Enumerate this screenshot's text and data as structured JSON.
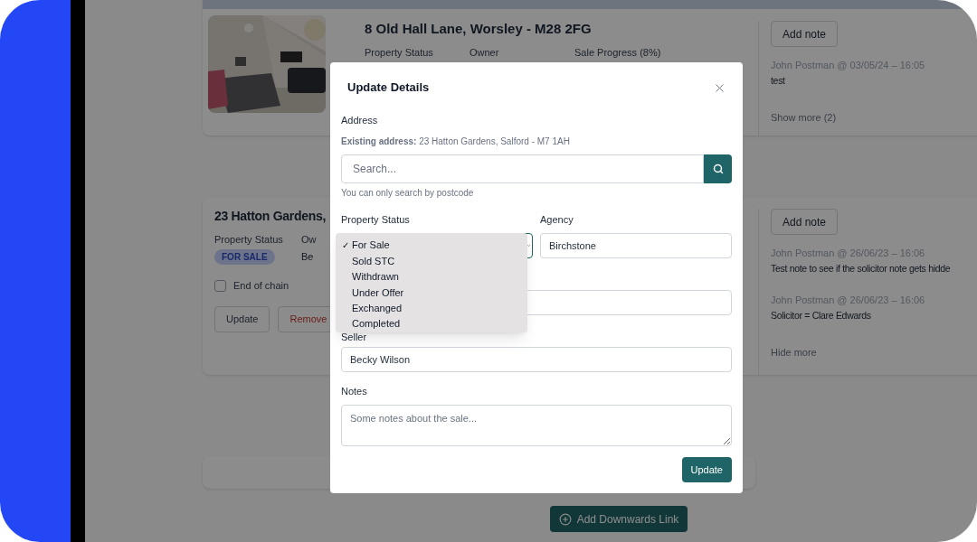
{
  "listing_cards": [
    {
      "title": "8 Old Hall Lane, Worsley - M28 2FG",
      "fields": [
        {
          "label": "Property Status"
        },
        {
          "label": "Owner"
        },
        {
          "label": "Sale Progress (8%)"
        }
      ],
      "notes_panel": {
        "button": "Add note",
        "notes": [
          {
            "meta": "John Postman @ 03/05/24 – 16:05",
            "text": "test"
          }
        ],
        "toggle": "Show more (2)"
      }
    },
    {
      "title": "23 Hatton Gardens,",
      "fields": [
        {
          "label": "Property Status",
          "badge": "FOR SALE"
        },
        {
          "label": "Ow",
          "value": "Be"
        }
      ],
      "checkbox": {
        "label": "End of chain",
        "checked": false
      },
      "buttons": [
        {
          "label": "Update",
          "kind": "default"
        },
        {
          "label": "Remove",
          "kind": "danger"
        }
      ],
      "notes_panel": {
        "button": "Add note",
        "notes": [
          {
            "meta": "John Postman @ 26/06/23 – 16:06",
            "text": "Test note to see if the solicitor note gets hidde"
          },
          {
            "meta": "John Postman @ 26/06/23 – 16:06",
            "text": "Solicitor = Clare Edwards"
          }
        ],
        "toggle": "Hide more"
      }
    }
  ],
  "footer_button": "Add Downwards Link",
  "modal": {
    "title": "Update Details",
    "address_label": "Address",
    "existing_address": "**Existing address:** 23 Hatton Gardens, Salford - M7 1AH",
    "search": {
      "placeholder": "Search..."
    },
    "search_hint": "You can only search by postcode",
    "property_status": {
      "label": "Property Status",
      "check": "✓",
      "options": [
        {
          "label": "For Sale",
          "selected": true
        },
        {
          "label": "Sold STC",
          "selected": false
        },
        {
          "label": "Withdrawn",
          "selected": false
        },
        {
          "label": "Under Offer",
          "selected": false
        },
        {
          "label": "Exchanged",
          "selected": false
        },
        {
          "label": "Completed",
          "selected": false
        }
      ]
    },
    "agency": {
      "label": "Agency",
      "value": "Birchstone"
    },
    "seller": {
      "label": "Seller",
      "value": "Becky Wilson"
    },
    "notes": {
      "label": "Notes",
      "placeholder": "Some notes about the sale..."
    },
    "submit": "Update"
  }
}
